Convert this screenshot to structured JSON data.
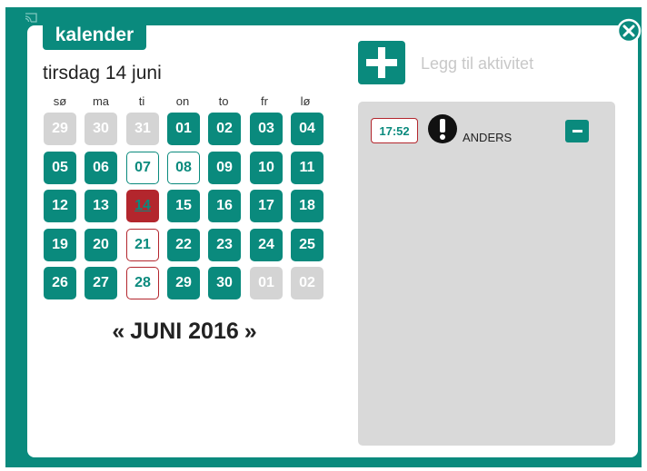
{
  "tab": {
    "label": "kalender"
  },
  "date_heading": "tirsdag 14 juni",
  "weekdays": [
    "sø",
    "ma",
    "ti",
    "on",
    "to",
    "fr",
    "lø"
  ],
  "calendar": {
    "weeks": [
      [
        {
          "d": "29",
          "s": "other"
        },
        {
          "d": "30",
          "s": "other"
        },
        {
          "d": "31",
          "s": "other"
        },
        {
          "d": "01",
          "s": "normal"
        },
        {
          "d": "02",
          "s": "normal"
        },
        {
          "d": "03",
          "s": "normal"
        },
        {
          "d": "04",
          "s": "normal"
        }
      ],
      [
        {
          "d": "05",
          "s": "normal"
        },
        {
          "d": "06",
          "s": "normal"
        },
        {
          "d": "07",
          "s": "marked"
        },
        {
          "d": "08",
          "s": "marked"
        },
        {
          "d": "09",
          "s": "normal"
        },
        {
          "d": "10",
          "s": "normal"
        },
        {
          "d": "11",
          "s": "normal"
        }
      ],
      [
        {
          "d": "12",
          "s": "normal"
        },
        {
          "d": "13",
          "s": "normal"
        },
        {
          "d": "14",
          "s": "today"
        },
        {
          "d": "15",
          "s": "normal"
        },
        {
          "d": "16",
          "s": "normal"
        },
        {
          "d": "17",
          "s": "normal"
        },
        {
          "d": "18",
          "s": "normal"
        }
      ],
      [
        {
          "d": "19",
          "s": "normal"
        },
        {
          "d": "20",
          "s": "normal"
        },
        {
          "d": "21",
          "s": "marked-red"
        },
        {
          "d": "22",
          "s": "normal"
        },
        {
          "d": "23",
          "s": "normal"
        },
        {
          "d": "24",
          "s": "normal"
        },
        {
          "d": "25",
          "s": "normal"
        }
      ],
      [
        {
          "d": "26",
          "s": "normal"
        },
        {
          "d": "27",
          "s": "normal"
        },
        {
          "d": "28",
          "s": "marked-red"
        },
        {
          "d": "29",
          "s": "normal"
        },
        {
          "d": "30",
          "s": "normal"
        },
        {
          "d": "01",
          "s": "other"
        },
        {
          "d": "02",
          "s": "other"
        }
      ]
    ]
  },
  "month_nav": {
    "prev": "«",
    "label": "JUNI 2016",
    "next": "»"
  },
  "add_activity": {
    "label": "Legg til aktivitet",
    "icon": "plus-icon"
  },
  "activities": [
    {
      "time": "17:52",
      "icon": "alert-icon",
      "name": "ANDERS",
      "remove_icon": "minus-icon"
    }
  ],
  "colors": {
    "accent": "#0a8a7d",
    "today": "#b3262d",
    "muted": "#d4d4d4",
    "panel": "#d9d9d9"
  }
}
